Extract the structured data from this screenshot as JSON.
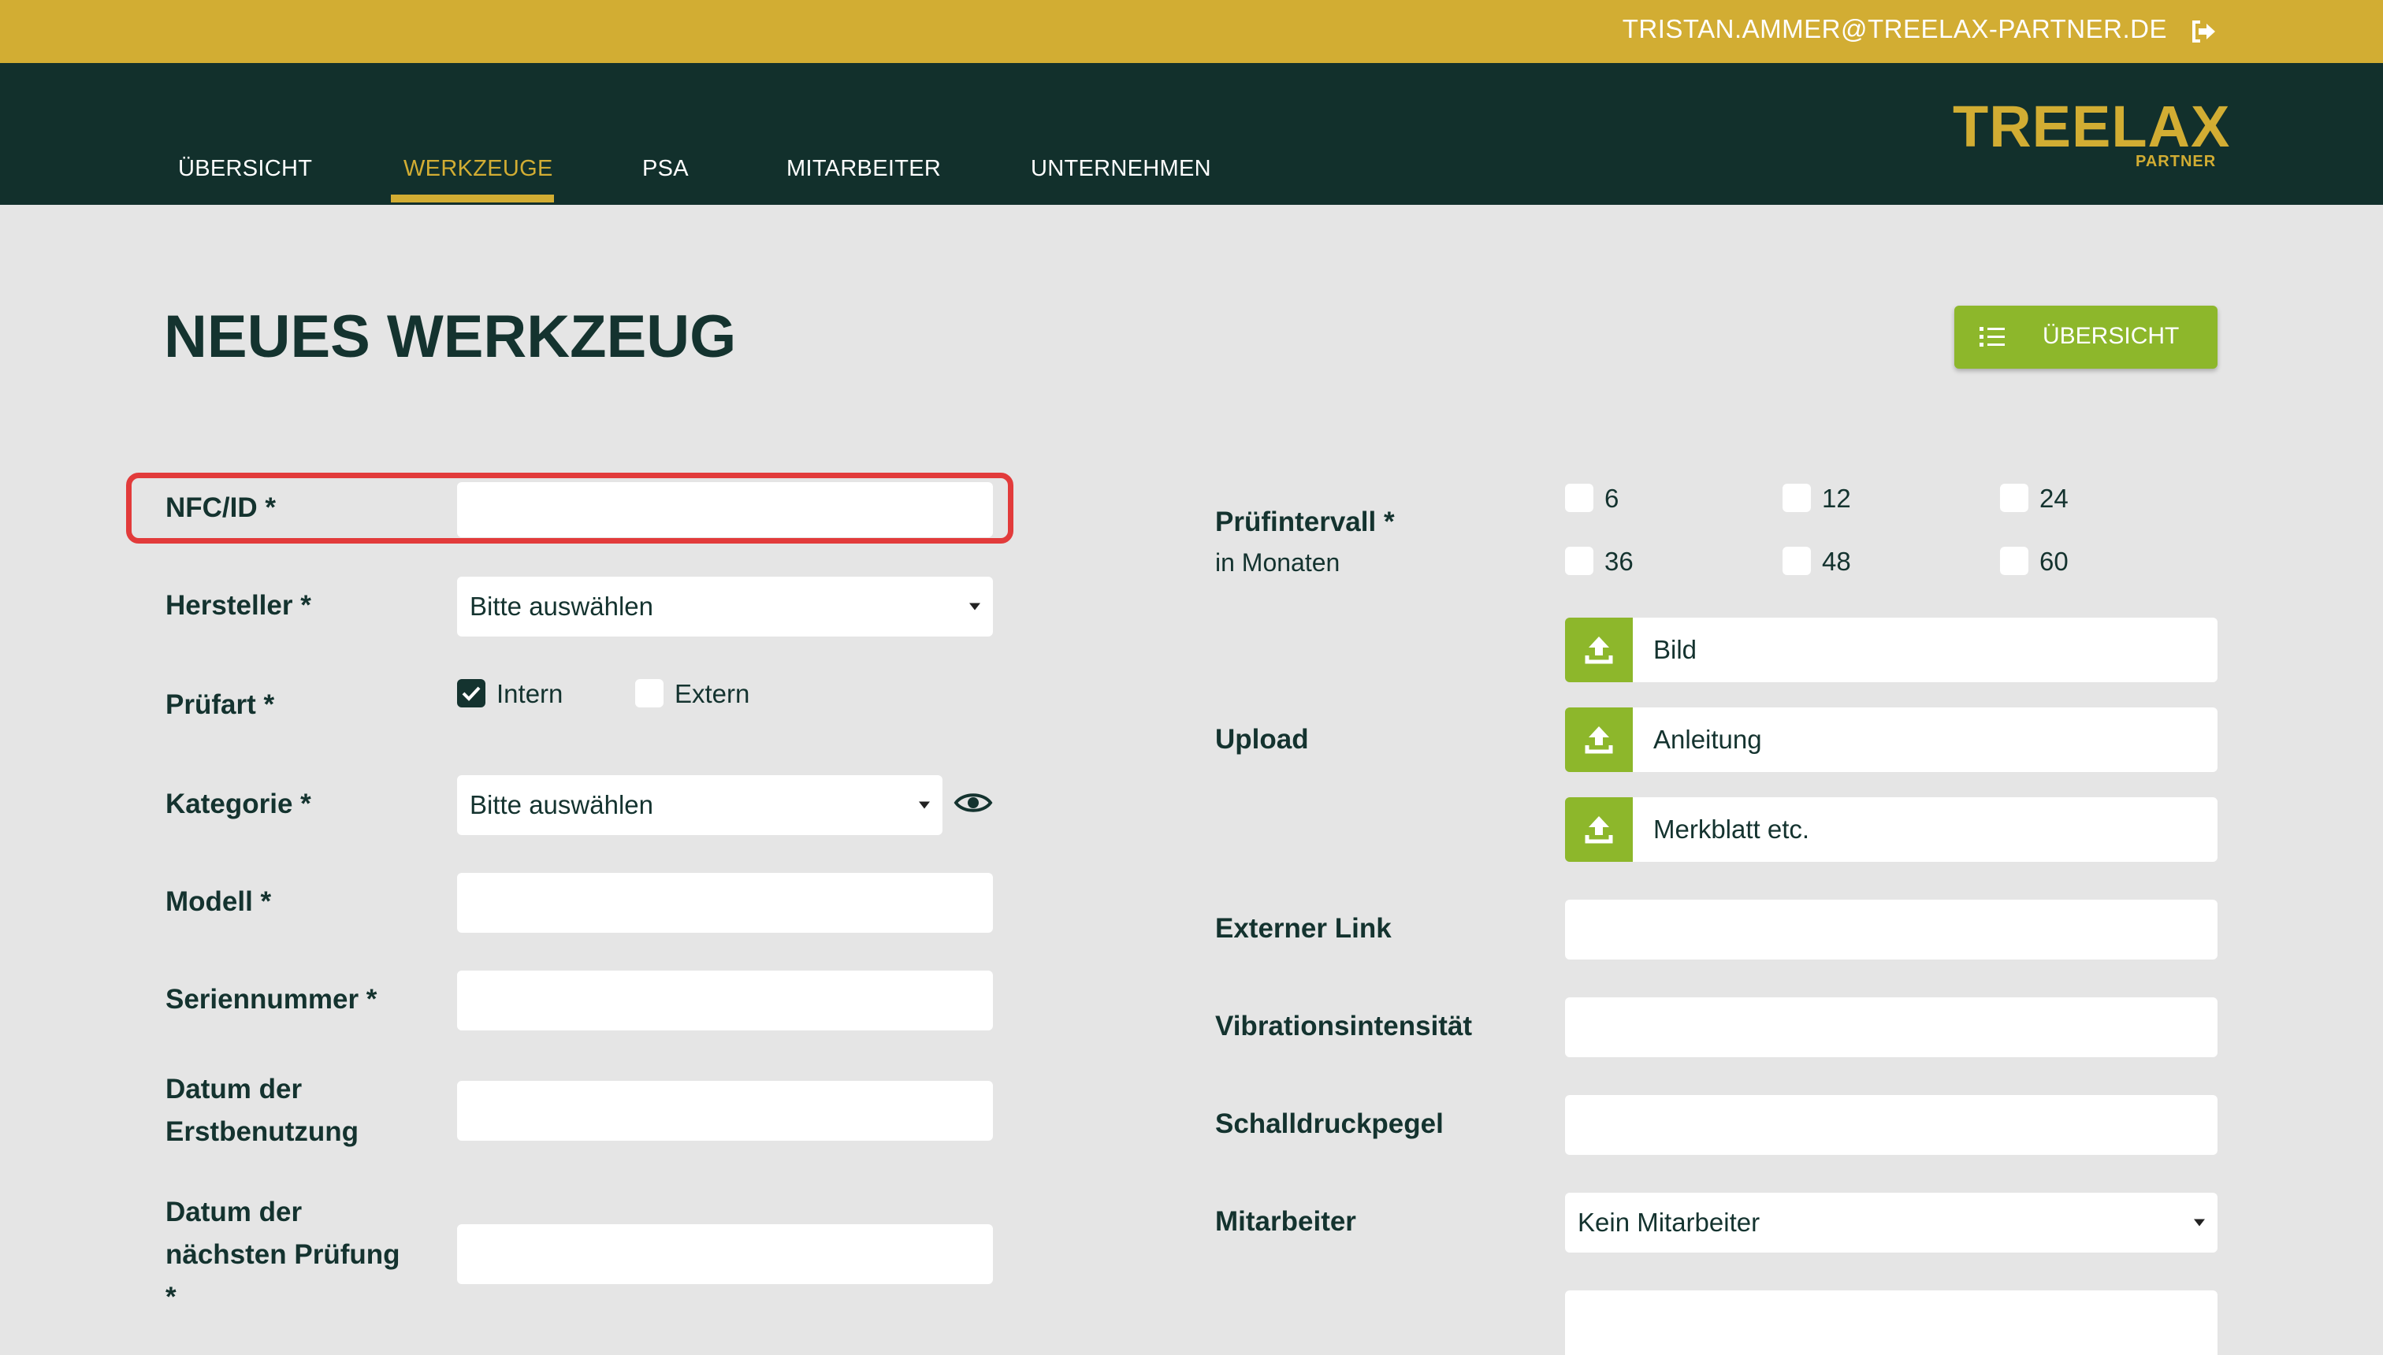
{
  "header": {
    "user_email": "TRISTAN.AMMER@TREELAX-PARTNER.DE",
    "logout_icon": "logout-icon"
  },
  "nav": {
    "items": [
      {
        "label": "ÜBERSICHT",
        "active": false
      },
      {
        "label": "WERKZEUGE",
        "active": true
      },
      {
        "label": "PSA",
        "active": false
      },
      {
        "label": "MITARBEITER",
        "active": false
      },
      {
        "label": "UNTERNEHMEN",
        "active": false
      }
    ],
    "logo_text": "TREELAX",
    "logo_sub": "PARTNER"
  },
  "page": {
    "title": "NEUES WERKZEUG",
    "overview_button": "ÜBERSICHT"
  },
  "colors": {
    "brand_gold": "#d2ad33",
    "nav_dark": "#12302c",
    "accent_green": "#8db72b",
    "highlight_red": "#e23b3b"
  },
  "form_left": {
    "nfc_label": "NFC/ID *",
    "nfc_value": "",
    "hersteller_label": "Hersteller *",
    "hersteller_value": "Bitte auswählen",
    "pruefart_label": "Prüfart *",
    "pruefart_options": [
      {
        "label": "Intern",
        "checked": true
      },
      {
        "label": "Extern",
        "checked": false
      }
    ],
    "kategorie_label": "Kategorie *",
    "kategorie_value": "Bitte auswählen",
    "modell_label": "Modell *",
    "seriennummer_label": "Seriennummer *",
    "erstbenutzung_label_1": "Datum der",
    "erstbenutzung_label_2": "Erstbenutzung",
    "naechste_pruefung_label_1": "Datum der",
    "naechste_pruefung_label_2": "nächsten Prüfung",
    "naechste_pruefung_label_3": "*"
  },
  "form_right": {
    "pruefintervall_label": "Prüfintervall *",
    "pruefintervall_sublabel": "in Monaten",
    "intervals": [
      "6",
      "12",
      "24",
      "36",
      "48",
      "60"
    ],
    "upload_label": "Upload",
    "uploads": [
      "Bild",
      "Anleitung",
      "Merkblatt etc."
    ],
    "externer_link_label": "Externer Link",
    "vibration_label": "Vibrationsintensität",
    "schalldruck_label": "Schalldruckpegel",
    "mitarbeiter_label": "Mitarbeiter",
    "mitarbeiter_value": "Kein Mitarbeiter"
  }
}
